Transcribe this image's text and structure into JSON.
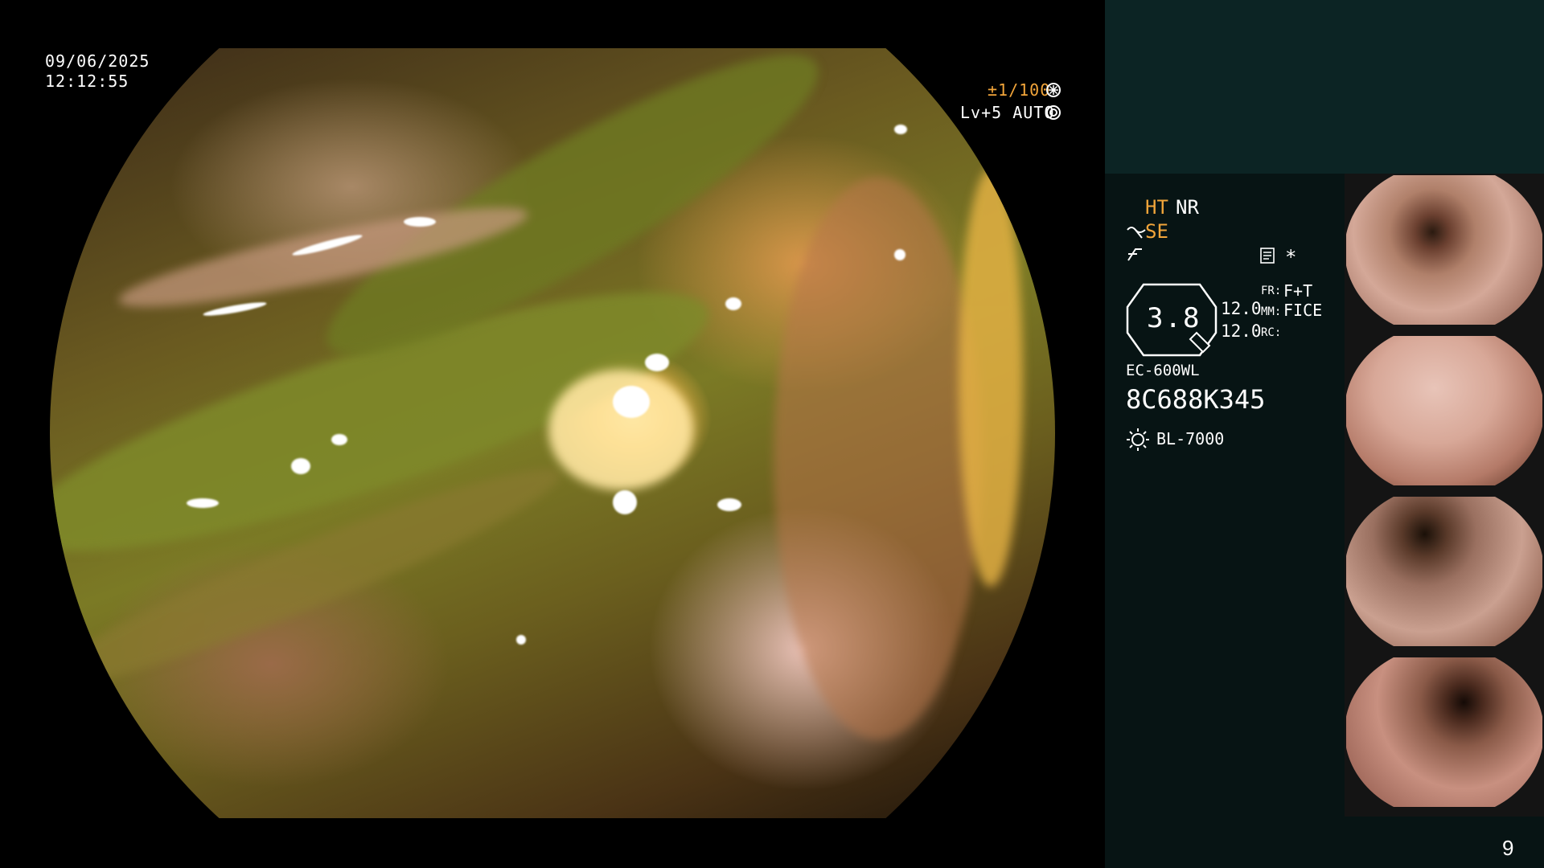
{
  "overlay": {
    "date": "09/06/2025",
    "time": "12:12:55",
    "shutter": "±1/100",
    "shutter_icon": "aperture-icon",
    "level_auto": "Lv+5 AUTO",
    "auto_icon": "iris-icon"
  },
  "settings": {
    "ht": "HT",
    "nr": "NR",
    "se": "SE",
    "se_icon": "tilde-arrow-icon",
    "f_icon": "f-curve-icon",
    "doc_icon": "document-icon",
    "star": "*",
    "zoom_value": "3.8",
    "val1": "12.0",
    "val2": "12.0",
    "fr_label": "FR:",
    "fr_value": "F+T",
    "mm_label": "MM:",
    "mm_value": "FICE",
    "rc_label": "RC:",
    "scope_model": "EC-600WL",
    "serial": "8C688K345",
    "light_source": "BL-7000",
    "light_icon": "sun-icon"
  },
  "colors": {
    "accent_orange": "#f2a53a",
    "panel_top": "#0c2424",
    "panel_bg": "#071414"
  },
  "page_number": "9"
}
